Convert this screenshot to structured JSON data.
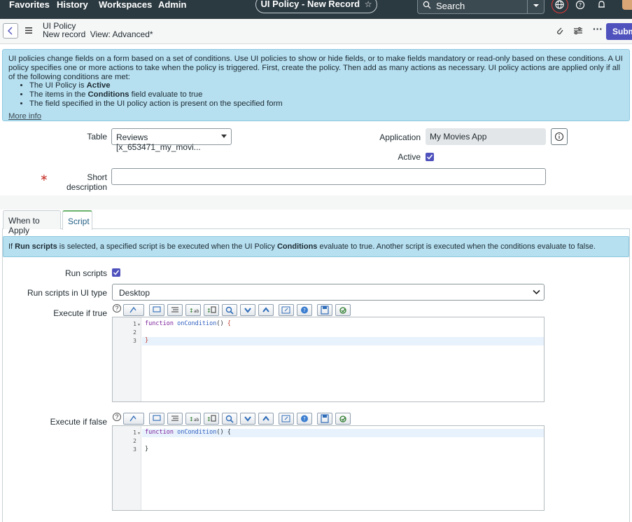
{
  "topnav": {
    "menus": [
      "Favorites",
      "History",
      "Workspaces",
      "Admin"
    ],
    "title": "UI Policy - New Record",
    "search_label": "Search"
  },
  "header": {
    "title": "UI Policy",
    "subtitle_record": "New record",
    "subtitle_view": "View: Advanced*",
    "submit_label": "Subm"
  },
  "info_banner": {
    "text": "UI policies change fields on a form based on a set of conditions. Use UI policies to show or hide fields, or to make fields mandatory or read-only based on these conditions. A UI policy specifies one or more actions to take when the policy is triggered. First, create the policy. Then add as many actions as necessary. UI policy actions are applied only if all of the following conditions are met:",
    "bullets": [
      {
        "pre": "The UI Policy is ",
        "bold": "Active",
        "post": ""
      },
      {
        "pre": "The items in the ",
        "bold": "Conditions",
        "post": " field evaluate to true"
      },
      {
        "pre": "The field specified in the UI policy action is present on the specified form",
        "bold": "",
        "post": ""
      }
    ],
    "more_info": "More info"
  },
  "form": {
    "table_label": "Table",
    "table_value": "Reviews [x_653471_my_movi...",
    "application_label": "Application",
    "application_value": "My Movies App",
    "active_label": "Active",
    "active_checked": true,
    "short_description_label": "Short description",
    "short_description_value": ""
  },
  "tabs": [
    "When to Apply",
    "Script"
  ],
  "active_tab": "Script",
  "script_banner": {
    "part1": "If ",
    "bold1": "Run scripts",
    "part2": " is selected, a specified script is be executed when the UI Policy ",
    "bold2": "Conditions",
    "part3": " evaluate to true. Another script is executed when the conditions evaluate to false."
  },
  "script_form": {
    "run_scripts_label": "Run scripts",
    "run_scripts_checked": true,
    "ui_type_label": "Run scripts in UI type",
    "ui_type_value": "Desktop",
    "execute_true_label": "Execute if true",
    "execute_false_label": "Execute if false"
  },
  "editor_true": {
    "line_numbers": [
      "1",
      "2",
      "3"
    ],
    "lines": [
      "function onCondition() {",
      "",
      "}"
    ]
  },
  "editor_false": {
    "line_numbers": [
      "1",
      "2",
      "3"
    ],
    "lines": [
      "function onCondition() {",
      "",
      "}"
    ]
  },
  "colors": {
    "nav_bg": "#2b3a41",
    "banner_bg": "#b6dff0",
    "accent": "#4f52bd",
    "required": "#c8352d"
  }
}
